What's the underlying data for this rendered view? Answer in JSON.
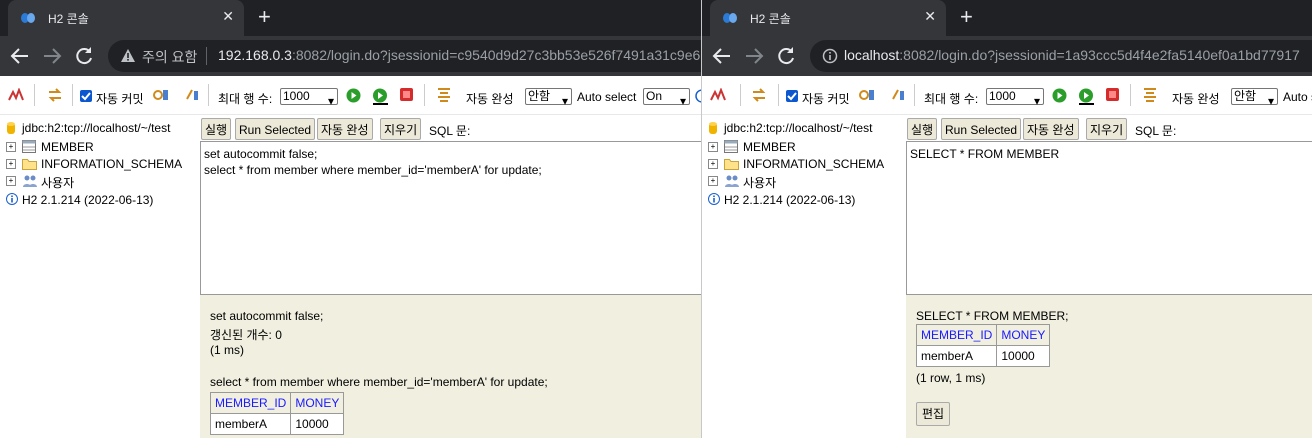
{
  "left": {
    "tab_title": "H2 콘솔",
    "security_label": "주의 요함",
    "url_host": "192.168.0.3",
    "url_rest": ":8082/login.do?jsessionid=c9540d9d27c3bb53e526f7491a31c9e6",
    "toolbar": {
      "auto_commit": "자동 커밋",
      "max_rows_label": "최대 행 수:",
      "max_rows_value": "1000",
      "autocomplete_label": "자동 완성",
      "autocomplete_value": "안함",
      "auto_select_label": "Auto select",
      "auto_select_value": "On"
    },
    "tree": {
      "connection": "jdbc:h2:tcp://localhost/~/test",
      "items": [
        "MEMBER",
        "INFORMATION_SCHEMA",
        "사용자"
      ],
      "version": "H2 2.1.214 (2022-06-13)"
    },
    "commands": {
      "run": "실행",
      "run_selected": "Run Selected",
      "autocomplete": "자동 완성",
      "clear": "지우기",
      "sql_label": "SQL 문:"
    },
    "editor_lines": [
      "set autocommit false;",
      "select * from member where member_id='memberA' for update;"
    ],
    "result": {
      "stmt1": "set autocommit false;",
      "updated": "갱신된 개수: 0",
      "time1": "(1 ms)",
      "stmt2": "select * from member where member_id='memberA' for update;",
      "headers": [
        "MEMBER_ID",
        "MONEY"
      ],
      "row": [
        "memberA",
        "10000"
      ]
    }
  },
  "right": {
    "tab_title": "H2 콘솔",
    "url_host": "localhost",
    "url_rest": ":8082/login.do?jsessionid=1a93ccc5d4f4e2fa5140ef0a1bd77917",
    "toolbar": {
      "auto_commit": "자동 커밋",
      "max_rows_label": "최대 행 수:",
      "max_rows_value": "1000",
      "autocomplete_label": "자동 완성",
      "autocomplete_value": "안함",
      "auto_select_label": "Auto s"
    },
    "tree": {
      "connection": "jdbc:h2:tcp://localhost/~/test",
      "items": [
        "MEMBER",
        "INFORMATION_SCHEMA",
        "사용자"
      ],
      "version": "H2 2.1.214 (2022-06-13)"
    },
    "commands": {
      "run": "실행",
      "run_selected": "Run Selected",
      "autocomplete": "자동 완성",
      "clear": "지우기",
      "sql_label": "SQL 문:"
    },
    "editor_lines": [
      "SELECT * FROM MEMBER"
    ],
    "result": {
      "stmt": "SELECT * FROM MEMBER;",
      "headers": [
        "MEMBER_ID",
        "MONEY"
      ],
      "row": [
        "memberA",
        "10000"
      ],
      "summary": "(1 row, 1 ms)",
      "edit": "편집"
    }
  }
}
